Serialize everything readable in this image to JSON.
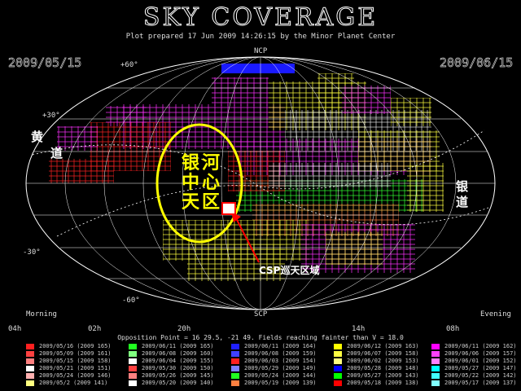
{
  "header": {
    "title": "SKY COVERAGE",
    "subtitle": "Plot prepared 17 Jun 2009 14:26:15 by the Minor Planet Center",
    "date_left": "2009/05/15",
    "date_right": "2009/06/15"
  },
  "map": {
    "pole_north": "NCP",
    "pole_south": "SCP",
    "dec_labels": {
      "p60": "+60°",
      "p30": "+30°",
      "m30": "-30°",
      "m60": "-60°"
    },
    "ra_labels": [
      "04h",
      "02h",
      "20h",
      "14h",
      "08h"
    ],
    "morning": "Morning",
    "evening": "Evening",
    "ecliptic_label": [
      "黄",
      "道"
    ],
    "galaxy_label": [
      "银",
      "道"
    ],
    "galactic_center_label": [
      "银",
      "河",
      "中",
      "心",
      "天",
      "区"
    ],
    "csp_label": "CSP巡天区域",
    "colors": {
      "ellipse": "#ffff00",
      "arrow": "#ff0000",
      "marker": "#ff0000"
    }
  },
  "footer": {
    "opposition_note": "Opposition Point = 16 29.5, -21 49.   Fields reaching fainter than V = 18.0"
  },
  "legend": {
    "columns": [
      [
        {
          "label": "2009/05/16 (2009 165)",
          "color": "#ff2020"
        },
        {
          "label": "2009/05/09 (2009 161)",
          "color": "#ff4040"
        },
        {
          "label": "2009/05/15 (2009 158)",
          "color": "#ff8080"
        },
        {
          "label": "2009/05/21 (2009 151)",
          "color": "#ffffff"
        },
        {
          "label": "2009/05/24 (2009 146)",
          "color": "#ffb0b0"
        },
        {
          "label": "2009/05/2 (2009 141)",
          "color": "#ffff80"
        }
      ],
      [
        {
          "label": "2009/06/11 (2009 165)",
          "color": "#20ff20"
        },
        {
          "label": "2009/06/08 (2009 160)",
          "color": "#80ff80"
        },
        {
          "label": "2009/06/04 (2009 155)",
          "color": "#ffffff"
        },
        {
          "label": "2009/05/30 (2009 150)",
          "color": "#ff4040"
        },
        {
          "label": "2009/05/26 (2009 145)",
          "color": "#ff8080"
        },
        {
          "label": "2009/05/20 (2009 140)",
          "color": "#ffffff"
        }
      ],
      [
        {
          "label": "2009/06/11 (2009 164)",
          "color": "#2020ff"
        },
        {
          "label": "2009/06/08 (2009 159)",
          "color": "#4040ff"
        },
        {
          "label": "2009/06/03 (2009 154)",
          "color": "#ff2020"
        },
        {
          "label": "2009/05/29 (2009 149)",
          "color": "#8080ff"
        },
        {
          "label": "2009/05/24 (2009 144)",
          "color": "#20ff20"
        },
        {
          "label": "2009/05/19 (2009 139)",
          "color": "#ff8040"
        }
      ],
      [
        {
          "label": "2009/06/12 (2009 163)",
          "color": "#ffff00"
        },
        {
          "label": "2009/06/07 (2009 158)",
          "color": "#ffff40"
        },
        {
          "label": "2009/06/02 (2009 153)",
          "color": "#ffff80"
        },
        {
          "label": "2009/05/28 (2009 148)",
          "color": "#0000ff"
        },
        {
          "label": "2009/05/27 (2009 143)",
          "color": "#00ff00"
        },
        {
          "label": "2009/05/18 (2009 138)",
          "color": "#ff0000"
        }
      ],
      [
        {
          "label": "2009/06/11 (2009 162)",
          "color": "#ff00ff"
        },
        {
          "label": "2009/06/06 (2009 157)",
          "color": "#ff40ff"
        },
        {
          "label": "2009/06/01 (2009 152)",
          "color": "#ff80ff"
        },
        {
          "label": "2009/05/27 (2009 147)",
          "color": "#00ffff"
        },
        {
          "label": "2009/05/22 (2009 142)",
          "color": "#40ffff"
        },
        {
          "label": "2009/05/17 (2009 137)",
          "color": "#80ffff"
        }
      ]
    ]
  }
}
